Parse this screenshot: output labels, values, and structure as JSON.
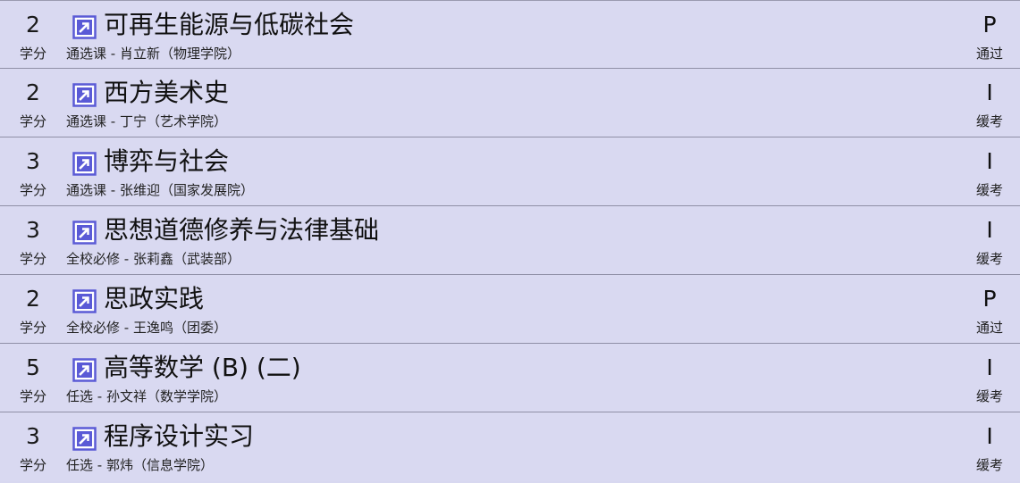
{
  "credit_unit_label": "学分",
  "courses": [
    {
      "credits": "2",
      "name": "可再生能源与低碳社会",
      "meta": "通选课 - 肖立新（物理学院）",
      "grade": "P",
      "grade_label": "通过"
    },
    {
      "credits": "2",
      "name": "西方美术史",
      "meta": "通选课 - 丁宁（艺术学院）",
      "grade": "I",
      "grade_label": "缓考"
    },
    {
      "credits": "3",
      "name": "博弈与社会",
      "meta": "通选课 - 张维迎（国家发展院）",
      "grade": "I",
      "grade_label": "缓考"
    },
    {
      "credits": "3",
      "name": "思想道德修养与法律基础",
      "meta": "全校必修 - 张莉鑫（武装部）",
      "grade": "I",
      "grade_label": "缓考"
    },
    {
      "credits": "2",
      "name": "思政实践",
      "meta": "全校必修 - 王逸鸣（团委）",
      "grade": "P",
      "grade_label": "通过"
    },
    {
      "credits": "5",
      "name": "高等数学 (B) (二)",
      "meta": "任选 - 孙文祥（数学学院）",
      "grade": "I",
      "grade_label": "缓考"
    },
    {
      "credits": "3",
      "name": "程序设计实习",
      "meta": "任选 - 郭炜（信息学院）",
      "grade": "I",
      "grade_label": "缓考"
    }
  ],
  "icon": "external-link-icon",
  "colors": {
    "row_background": "#d9d9f1",
    "divider": "#8f8fa6",
    "icon_accent": "#5a5ad6"
  }
}
